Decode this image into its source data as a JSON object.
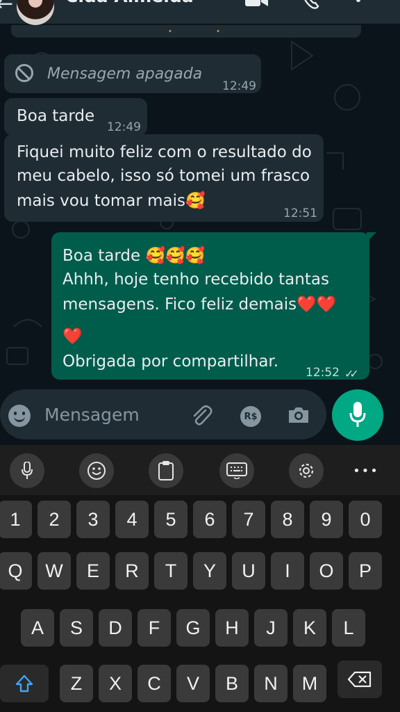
{
  "header": {
    "back_icon": "arrow-left-icon",
    "contact_name": "Cida Almeida",
    "icons": [
      "video-call-icon",
      "phone-icon",
      "more-vertical-icon"
    ]
  },
  "messages": [
    {
      "direction": "in",
      "deleted": true,
      "text": "Mensagem apagada",
      "time": "12:49"
    },
    {
      "direction": "in",
      "text": "Boa tarde",
      "time": "12:49"
    },
    {
      "direction": "in",
      "lines": [
        "Fiquei muito feliz com o resultado do",
        "meu cabelo, isso só tomei um frasco",
        "mais vou tomar mais🥰"
      ],
      "time": "12:51"
    },
    {
      "direction": "out",
      "lines": [
        "Boa tarde 🥰🥰🥰",
        "Ahhh, hoje tenho recebido tantas",
        "mensagens. Fico feliz demais❤️❤️",
        "❤️",
        "Obrigada por compartilhar."
      ],
      "time": "12:52",
      "status": "read"
    }
  ],
  "composer": {
    "placeholder": "Mensagem",
    "payment_label": "R$",
    "icons": [
      "emoji-icon",
      "attach-icon",
      "payment-icon",
      "camera-icon",
      "mic-icon"
    ]
  },
  "keyboard": {
    "toolbar": [
      "mic-icon",
      "emoji-icon",
      "clipboard-icon",
      "keyboard-icon",
      "settings-icon",
      "more-icon"
    ],
    "more_label": "•••",
    "row_numbers": [
      "1",
      "2",
      "3",
      "4",
      "5",
      "6",
      "7",
      "8",
      "9",
      "0"
    ],
    "row1": [
      "Q",
      "W",
      "E",
      "R",
      "T",
      "Y",
      "U",
      "I",
      "O",
      "P"
    ],
    "row2": [
      "A",
      "S",
      "D",
      "F",
      "G",
      "H",
      "J",
      "K",
      "L"
    ],
    "row3": [
      "Z",
      "X",
      "C",
      "V",
      "B",
      "N",
      "M"
    ]
  },
  "colors": {
    "incoming": "#1f2c34",
    "outgoing": "#005c4b",
    "accent": "#00a884"
  }
}
